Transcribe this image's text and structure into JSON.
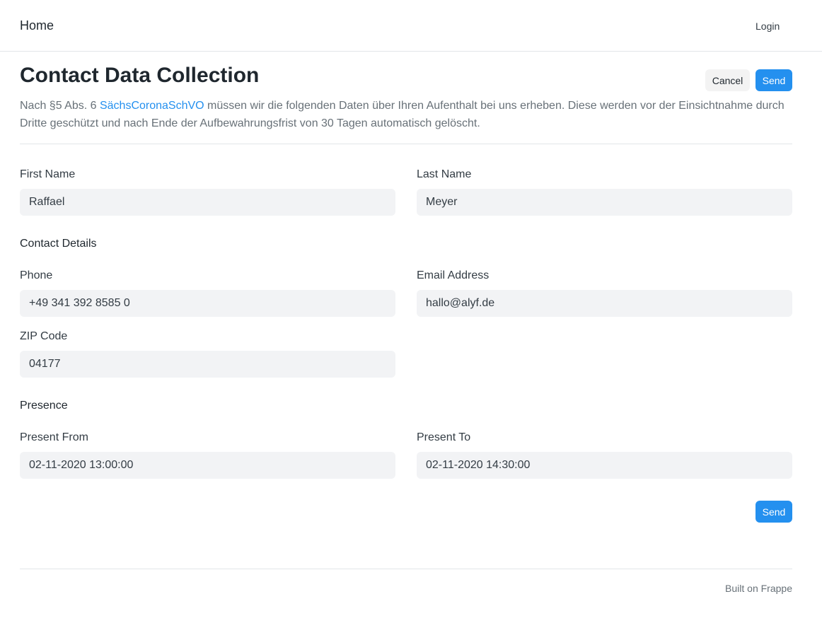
{
  "nav": {
    "brand": "Home",
    "login": "Login"
  },
  "header": {
    "title": "Contact Data Collection",
    "cancel_label": "Cancel",
    "send_label": "Send"
  },
  "intro": {
    "before": "Nach §5 Abs. 6 ",
    "link": "SächsCoronaSchVO",
    "after": " müssen wir die folgenden Daten über Ihren Aufenthalt bei uns erheben. Diese werden vor der Einsichtnahme durch Dritte geschützt und nach Ende der Aufbewahrungsfrist von 30 Tagen automatisch gelöscht."
  },
  "form": {
    "first_name": {
      "label": "First Name",
      "value": "Raffael"
    },
    "last_name": {
      "label": "Last Name",
      "value": "Meyer"
    },
    "contact_section": "Contact Details",
    "phone": {
      "label": "Phone",
      "value": "+49 341 392 8585 0"
    },
    "email": {
      "label": "Email Address",
      "value": "hallo@alyf.de"
    },
    "zip": {
      "label": "ZIP Code",
      "value": "04177"
    },
    "presence_section": "Presence",
    "present_from": {
      "label": "Present From",
      "value": "02-11-2020 13:00:00"
    },
    "present_to": {
      "label": "Present To",
      "value": "02-11-2020 14:30:00"
    },
    "send_label": "Send"
  },
  "footer": {
    "text": "Built on Frappe"
  },
  "colors": {
    "accent": "#2490ef",
    "input_bg": "#f2f3f5",
    "muted_text": "#687178"
  }
}
